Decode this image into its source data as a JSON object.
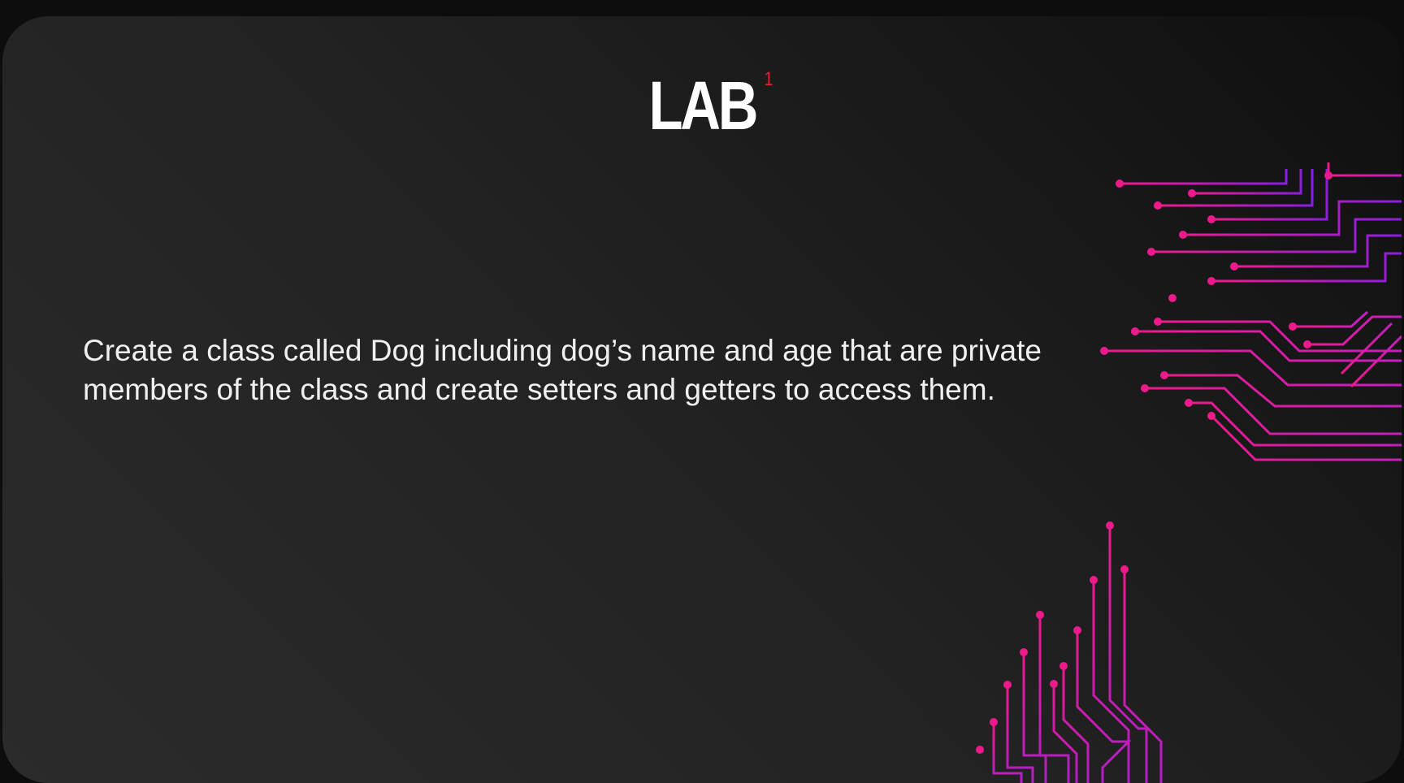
{
  "slide": {
    "title": "LAB",
    "title_superscript": "1",
    "body": "Create a class called Dog including dog’s name and age that are private members of the class and create setters and getters to access them."
  },
  "decorations": {
    "right_circuit": "circuit-traces-icon",
    "bottom_circuit": "circuit-traces-icon"
  },
  "colors": {
    "background": "#0d0d0d",
    "slide_dark": "#0f0f0f",
    "slide_light": "#2b2b2b",
    "title": "#ffffff",
    "superscript": "#e21f26",
    "text": "#f0f0f0",
    "trace_pink": "#e8168f",
    "trace_purple": "#8a1ee0"
  }
}
